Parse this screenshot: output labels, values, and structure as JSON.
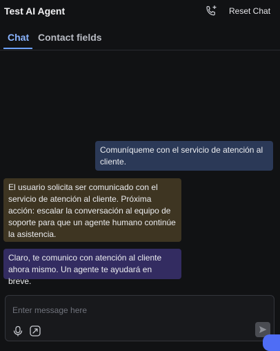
{
  "header": {
    "title": "Test AI Agent",
    "reset_label": "Reset Chat",
    "call_icon": "phone-plus-icon"
  },
  "tabs": [
    {
      "label": "Chat",
      "active": true
    },
    {
      "label": "Contact fields",
      "active": false
    }
  ],
  "messages": [
    {
      "role": "user",
      "text": "Comuníqueme con el servicio de atención al cliente."
    },
    {
      "role": "system",
      "text": "El usuario solicita ser comunicado con el servicio de atención al cliente. Próxima acción: escalar la conversación al equipo de soporte para que un agente humano continúe la asistencia."
    },
    {
      "role": "assistant",
      "text": "Claro, te comunico con atención al cliente ahora mismo. Un agente te ayudará en breve."
    }
  ],
  "composer": {
    "placeholder": "Enter message here",
    "value": "",
    "icons": [
      "microphone-icon",
      "ai-sparkle-icon",
      "send-icon"
    ]
  },
  "colors": {
    "background": "#111214",
    "accent": "#6ea2ff",
    "user_bubble": "#2b3957",
    "system_bubble": "#3e3522",
    "assistant_bubble": "#332c61",
    "launcher": "#4f6df5"
  }
}
